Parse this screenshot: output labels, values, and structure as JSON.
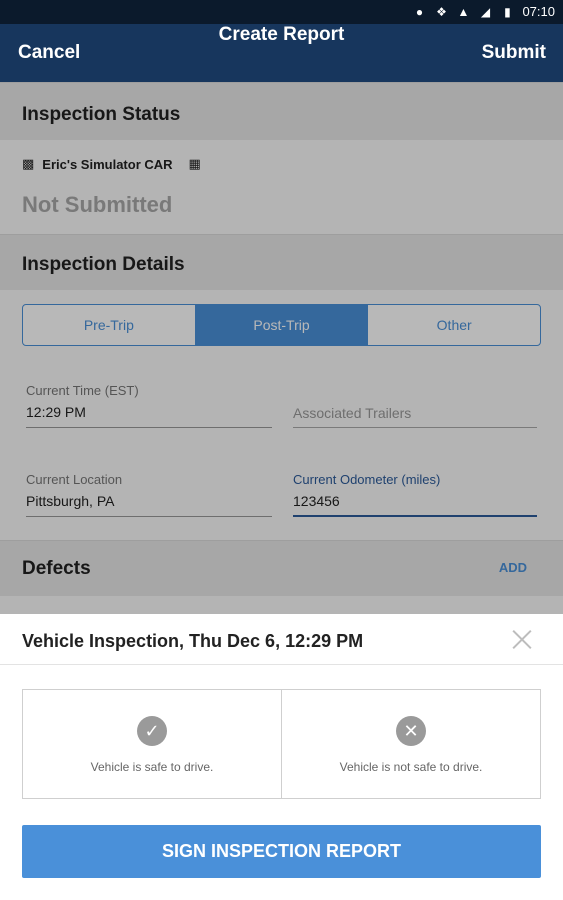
{
  "status_bar": {
    "time": "07:10"
  },
  "app_bar": {
    "cancel_label": "Cancel",
    "title": "Create Report",
    "submit_label": "Submit"
  },
  "inspection_status": {
    "heading": "Inspection Status",
    "vehicle_name": "Eric's Simulator CAR",
    "status": "Not Submitted"
  },
  "inspection_details": {
    "heading": "Inspection Details",
    "trip_types": [
      "Pre-Trip",
      "Post-Trip",
      "Other"
    ],
    "selected_trip_type": "Post-Trip",
    "current_time_label": "Current Time (EST)",
    "current_time_value": "12:29 PM",
    "trailers_placeholder": "Associated Trailers",
    "location_label": "Current Location",
    "location_value": "Pittsburgh, PA",
    "odometer_label": "Current Odometer (miles)",
    "odometer_value": "123456"
  },
  "defects": {
    "heading": "Defects",
    "add_label": "ADD"
  },
  "sheet": {
    "title": "Vehicle Inspection, Thu Dec 6, 12:29 PM",
    "safe_label": "Vehicle is safe to drive.",
    "unsafe_label": "Vehicle is not safe to drive.",
    "sign_label": "SIGN INSPECTION REPORT"
  },
  "colors": {
    "app_bar": "#17365d",
    "accent": "#4a90d9",
    "status_bar": "#0b1a2c"
  }
}
